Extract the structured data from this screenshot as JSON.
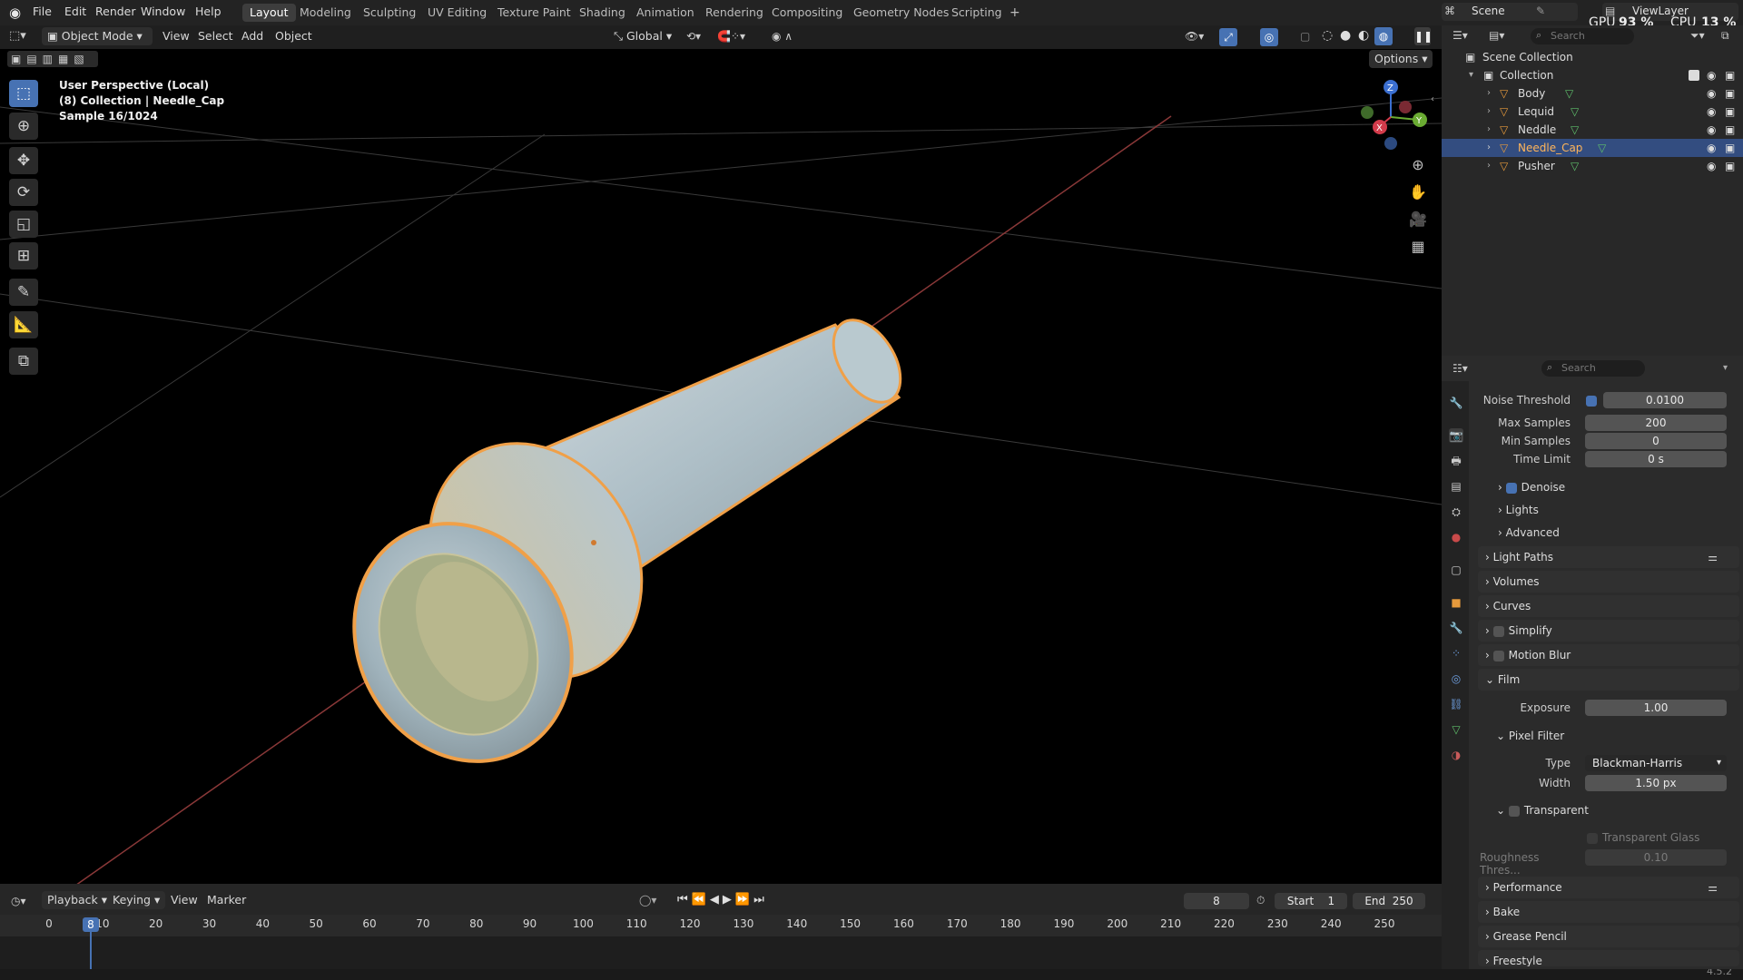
{
  "topbar": {
    "menus": [
      "File",
      "Edit",
      "Render",
      "Window",
      "Help"
    ],
    "workspaces": [
      "Layout",
      "Modeling",
      "Sculpting",
      "UV Editing",
      "Texture Paint",
      "Shading",
      "Animation",
      "Rendering",
      "Compositing",
      "Geometry Nodes",
      "Scripting"
    ],
    "active_workspace": "Layout",
    "add_workspace": "+",
    "scene": "Scene",
    "view_layer": "ViewLayer",
    "gpu_label": "GPU",
    "gpu_value": "93 %",
    "cpu_label": "CPU",
    "cpu_value": "13 %"
  },
  "viewport_header": {
    "mode": "Object Mode",
    "menus": [
      "View",
      "Select",
      "Add",
      "Object"
    ],
    "transform_orientation": "Global",
    "options": "Options"
  },
  "viewport_overlay": {
    "line1": "User Perspective (Local)",
    "line2": "(8) Collection | Needle_Cap",
    "line3": "Sample 16/1024"
  },
  "gizmo": {
    "z": "Z",
    "y": "Y",
    "x": "X"
  },
  "timeline": {
    "menus": [
      "Playback",
      "Keying",
      "View",
      "Marker"
    ],
    "current_frame": "8",
    "start_label": "Start",
    "start": "1",
    "end_label": "End",
    "end": "250",
    "ticks": [
      "0",
      "10",
      "20",
      "30",
      "40",
      "50",
      "60",
      "70",
      "80",
      "90",
      "100",
      "110",
      "120",
      "130",
      "140",
      "150",
      "160",
      "170",
      "180",
      "190",
      "200",
      "210",
      "220",
      "230",
      "240",
      "250"
    ],
    "playhead": "8"
  },
  "outliner": {
    "search_placeholder": "Search",
    "root": "Scene Collection",
    "collection": "Collection",
    "objects": [
      "Body",
      "Lequid",
      "Neddle",
      "Needle_Cap",
      "Pusher"
    ],
    "selected": "Needle_Cap"
  },
  "properties": {
    "search_placeholder": "Search",
    "noise_threshold_label": "Noise Threshold",
    "noise_threshold": "0.0100",
    "max_samples_label": "Max Samples",
    "max_samples": "200",
    "min_samples_label": "Min Samples",
    "min_samples": "0",
    "time_limit_label": "Time Limit",
    "time_limit": "0 s",
    "denoise": "Denoise",
    "lights": "Lights",
    "advanced": "Advanced",
    "sections": [
      "Light Paths",
      "Volumes",
      "Curves",
      "Simplify",
      "Motion Blur",
      "Film"
    ],
    "exposure_label": "Exposure",
    "exposure": "1.00",
    "pixel_filter": "Pixel Filter",
    "type_label": "Type",
    "type_value": "Blackman-Harris",
    "width_label": "Width",
    "width_value": "1.50 px",
    "transparent": "Transparent",
    "transparent_glass": "Transparent Glass",
    "roughness_label": "Roughness Thres...",
    "roughness_value": "0.10",
    "bottom_sections": [
      "Performance",
      "Bake",
      "Grease Pencil",
      "Freestyle"
    ]
  },
  "status": {
    "version": "4.5.2"
  },
  "colors": {
    "accent": "#4772b3",
    "selection": "#334d80",
    "object_orange": "#e69a3c",
    "mesh_green": "#5fbf6b"
  }
}
